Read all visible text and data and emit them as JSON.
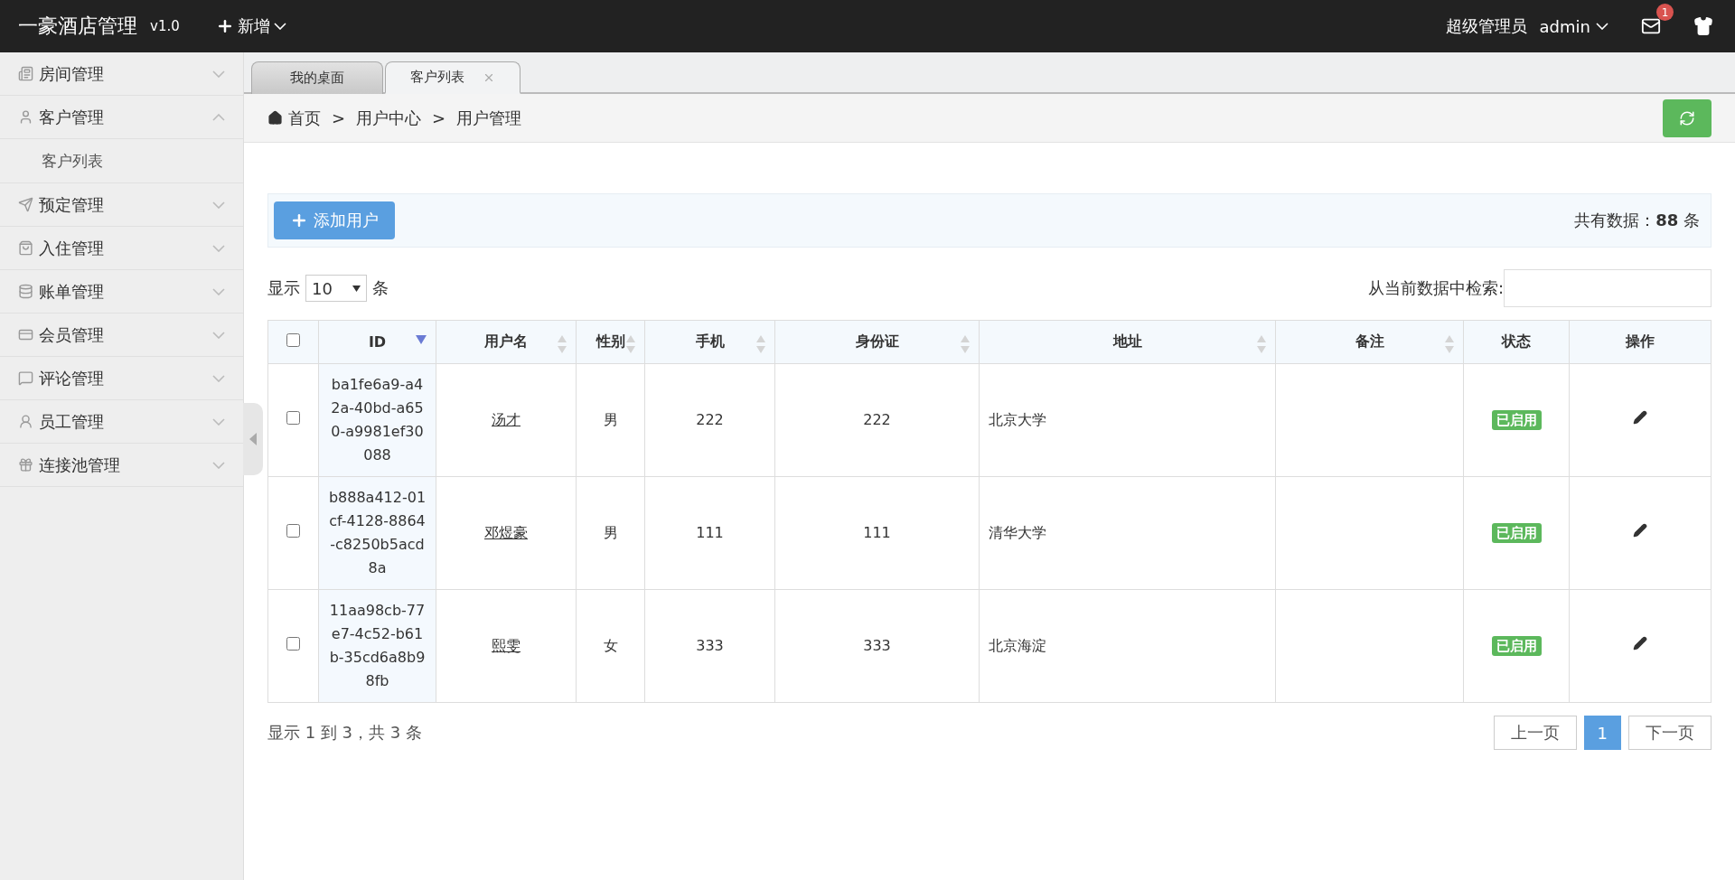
{
  "header": {
    "logo": "一豪酒店管理",
    "version": "v1.0",
    "new_menu": "新增",
    "role": "超级管理员",
    "user": "admin",
    "mail_badge": "1"
  },
  "sidebar": {
    "items": [
      {
        "label": "房间管理",
        "expanded": false
      },
      {
        "label": "客户管理",
        "expanded": true,
        "children": [
          {
            "label": "客户列表"
          }
        ]
      },
      {
        "label": "预定管理",
        "expanded": false
      },
      {
        "label": "入住管理",
        "expanded": false
      },
      {
        "label": "账单管理",
        "expanded": false
      },
      {
        "label": "会员管理",
        "expanded": false
      },
      {
        "label": "评论管理",
        "expanded": false
      },
      {
        "label": "员工管理",
        "expanded": false
      },
      {
        "label": "连接池管理",
        "expanded": false
      }
    ]
  },
  "tabs": [
    {
      "label": "我的桌面",
      "selected": false,
      "closable": false
    },
    {
      "label": "客户列表",
      "selected": true,
      "closable": true
    }
  ],
  "breadcrumb": {
    "items": [
      "首页",
      "用户中心",
      "用户管理"
    ],
    "separators": [
      ">",
      ">"
    ]
  },
  "toolbar": {
    "add_button": "添加用户",
    "total_label": "共有数据：",
    "total": "88",
    "total_unit": "条"
  },
  "length": {
    "prefix": "显示",
    "value": "10",
    "suffix": "条"
  },
  "search": {
    "label": "从当前数据中检索:"
  },
  "table": {
    "select_all_checked": false,
    "columns": [
      {
        "label": "ID",
        "sortable": true,
        "sorted": true
      },
      {
        "label": "用户名",
        "sortable": true,
        "sorted": false
      },
      {
        "label": "性别",
        "sortable": true,
        "sorted": false
      },
      {
        "label": "手机",
        "sortable": true,
        "sorted": false
      },
      {
        "label": "身份证",
        "sortable": true,
        "sorted": false
      },
      {
        "label": "地址",
        "sortable": true,
        "sorted": false
      },
      {
        "label": "备注",
        "sortable": true,
        "sorted": false
      },
      {
        "label": "状态",
        "sortable": false
      },
      {
        "label": "操作",
        "sortable": false
      }
    ],
    "rows": [
      {
        "checked": false,
        "id": "ba1fe6a9-a42a-40bd-a650-a9981ef30088",
        "username": "汤才",
        "gender": "男",
        "phone": "222",
        "id_card": "222",
        "address": "北京大学",
        "status": {
          "label": "已启用",
          "kind": "enabled"
        }
      },
      {
        "checked": false,
        "id": "b888a412-01cf-4128-8864-c8250b5acd8a",
        "username": "邓煜豪",
        "gender": "男",
        "phone": "111",
        "id_card": "111",
        "address": "清华大学",
        "status": {
          "label": "已启用",
          "kind": "enabled"
        }
      },
      {
        "checked": false,
        "id": "11aa98cb-77e7-4c52-b61b-35cd6a8b98fb",
        "username": "熙雯",
        "gender": "女",
        "phone": "333",
        "id_card": "333",
        "address": "北京海淀",
        "status": {
          "label": "已启用",
          "kind": "enabled"
        }
      }
    ]
  },
  "footer": {
    "info": "显示 1 到 3，共 3 条",
    "prev": "上一页",
    "pages": [
      {
        "label": "1",
        "selected": true
      }
    ],
    "next": "下一页"
  }
}
